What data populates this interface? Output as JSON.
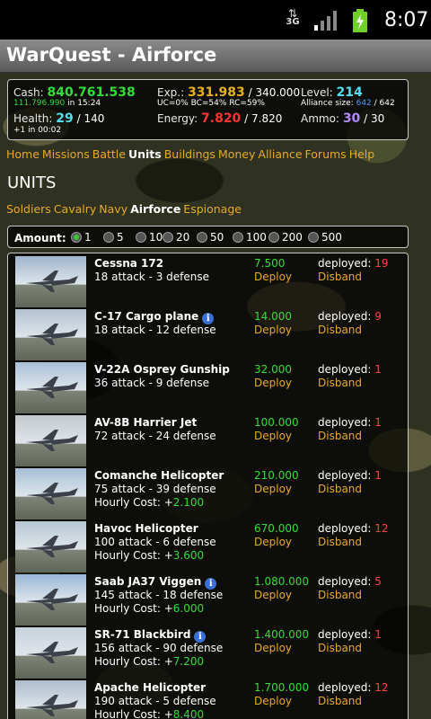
{
  "statusbar": {
    "network": "3G",
    "time": "8:07"
  },
  "app": {
    "title": "WarQuest - Airforce"
  },
  "stats": {
    "cash_label": "Cash:",
    "cash_value": "840.761.538",
    "bank_value": "111.796.990",
    "bank_suffix": "in 15:24",
    "health_label": "Health:",
    "health_value": "29",
    "health_max": "/ 140",
    "health_note": "+1 in 00:02",
    "exp_label": "Exp.:",
    "exp_value": "331.983",
    "exp_max": "/ 340.000",
    "uc": "UC=0%",
    "bc": "BC=54%",
    "rc": "RC=59%",
    "energy_label": "Energy:",
    "energy_value": "7.820",
    "energy_max": "/ 7.820",
    "level_label": "Level:",
    "level_value": "214",
    "alliance_label": "Alliance size:",
    "alliance_value": "642",
    "alliance_max": "/ 642",
    "ammo_label": "Ammo:",
    "ammo_value": "30",
    "ammo_max": "/ 30"
  },
  "nav": [
    "Home",
    "Missions",
    "Battle",
    "Units",
    "Buildings",
    "Money",
    "Alliance",
    "Forums",
    "Help"
  ],
  "nav_active": "Units",
  "heading": "UNITS",
  "subnav": [
    "Soldiers",
    "Cavalry",
    "Navy",
    "Airforce",
    "Espionage"
  ],
  "subnav_active": "Airforce",
  "amount": {
    "label": "Amount:",
    "options": [
      "1",
      "5",
      "10",
      "20",
      "50",
      "100",
      "200",
      "500"
    ],
    "selected": "1"
  },
  "units": [
    {
      "name": "Cessna 172",
      "stats": "18 attack - 3 defense",
      "cost": "",
      "price": "7.500",
      "deployed": "19",
      "info": false
    },
    {
      "name": "C-17 Cargo plane",
      "stats": "18 attack - 12 defense",
      "cost": "",
      "price": "14.000",
      "deployed": "9",
      "info": true
    },
    {
      "name": "V-22A Osprey Gunship",
      "stats": "36 attack - 9 defense",
      "cost": "",
      "price": "32.000",
      "deployed": "1",
      "info": false
    },
    {
      "name": "AV-8B Harrier Jet",
      "stats": "72 attack - 24 defense",
      "cost": "",
      "price": "100.000",
      "deployed": "1",
      "info": false
    },
    {
      "name": "Comanche Helicopter",
      "stats": "75 attack - 39 defense",
      "cost": "2.100",
      "price": "210.000",
      "deployed": "1",
      "info": false
    },
    {
      "name": "Havoc Helicopter",
      "stats": "100 attack - 6 defense",
      "cost": "3.600",
      "price": "670.000",
      "deployed": "12",
      "info": false
    },
    {
      "name": "Saab JA37 Viggen",
      "stats": "145 attack - 18 defense",
      "cost": "6.000",
      "price": "1.080.000",
      "deployed": "5",
      "info": true
    },
    {
      "name": "SR-71 Blackbird",
      "stats": "156 attack - 90 defense",
      "cost": "7.200",
      "price": "1.400.000",
      "deployed": "1",
      "info": true
    },
    {
      "name": "Apache Helicopter",
      "stats": "190 attack - 5 defense",
      "cost": "8.400",
      "price": "1.700.000",
      "deployed": "12",
      "info": false
    }
  ],
  "labels": {
    "deploy": "Deploy",
    "disband": "Disband",
    "deployed": "deployed:",
    "hourly": "Hourly Cost: +",
    "info": "i"
  },
  "colors": {
    "money": "#33dd33",
    "link": "#e8a92a",
    "health": "#55ddee",
    "energy": "#ff3333",
    "ammo": "#b288ff"
  }
}
